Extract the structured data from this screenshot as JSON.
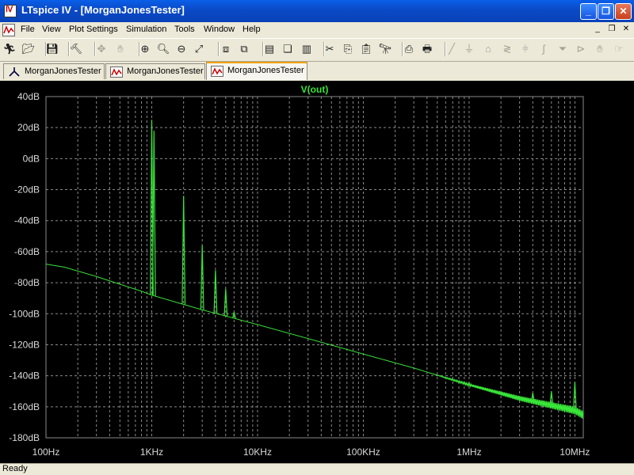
{
  "window": {
    "title": "LTspice IV - [MorganJonesTester]",
    "minimize_glyph": "_",
    "restore_glyph": "❐",
    "close_glyph": "✕"
  },
  "menu": {
    "items": [
      "File",
      "View",
      "Plot Settings",
      "Simulation",
      "Tools",
      "Window",
      "Help"
    ],
    "mdi_buttons": [
      "_",
      "❐",
      "✕"
    ]
  },
  "toolbar": {
    "icons": [
      {
        "name": "run-icon",
        "glyph": "🏃︎",
        "dim": false
      },
      {
        "name": "open-icon",
        "glyph": "📂︎",
        "dim": false
      },
      {
        "name": "save-icon",
        "glyph": "💾︎",
        "dim": false
      },
      {
        "name": "control-panel-icon",
        "glyph": "🔨︎",
        "dim": false
      },
      {
        "name": "halt-icon",
        "glyph": "✥",
        "dim": true
      },
      {
        "name": "pan-icon",
        "glyph": "✋︎",
        "dim": true
      },
      {
        "name": "zoom-in-icon",
        "glyph": "⊕",
        "dim": false
      },
      {
        "name": "zoom-area-icon",
        "glyph": "🔍︎",
        "dim": false
      },
      {
        "name": "zoom-out-icon",
        "glyph": "⊖",
        "dim": false
      },
      {
        "name": "zoom-fit-icon",
        "glyph": "⤢",
        "dim": false
      },
      {
        "name": "autorange-icon",
        "glyph": "⧈",
        "dim": false
      },
      {
        "name": "plot-setup-icon",
        "glyph": "⧉",
        "dim": false
      },
      {
        "name": "tile-horizontal-icon",
        "glyph": "▤",
        "dim": false
      },
      {
        "name": "cascade-icon",
        "glyph": "❏",
        "dim": false
      },
      {
        "name": "tile-vertical-icon",
        "glyph": "▥",
        "dim": false
      },
      {
        "name": "cut-icon",
        "glyph": "✂︎",
        "dim": false
      },
      {
        "name": "copy-icon",
        "glyph": "⎘",
        "dim": false
      },
      {
        "name": "paste-icon",
        "glyph": "📋︎",
        "dim": false
      },
      {
        "name": "find-icon",
        "glyph": "🔭︎",
        "dim": false
      },
      {
        "name": "print-setup-icon",
        "glyph": "⎙",
        "dim": false
      },
      {
        "name": "print-icon",
        "glyph": "🖶︎",
        "dim": false
      },
      {
        "name": "wire-icon",
        "glyph": "╱",
        "dim": true
      },
      {
        "name": "ground-icon",
        "glyph": "⏚",
        "dim": true
      },
      {
        "name": "label-icon",
        "glyph": "⌂",
        "dim": true
      },
      {
        "name": "resistor-icon",
        "glyph": "≷",
        "dim": true
      },
      {
        "name": "capacitor-icon",
        "glyph": "⫩",
        "dim": true
      },
      {
        "name": "inductor-icon",
        "glyph": "∫",
        "dim": true
      },
      {
        "name": "diode-icon",
        "glyph": "⏷",
        "dim": true
      },
      {
        "name": "component-icon",
        "glyph": "⊳",
        "dim": true
      },
      {
        "name": "move-icon",
        "glyph": "✋︎",
        "dim": true
      },
      {
        "name": "drag-icon",
        "glyph": "☞",
        "dim": true
      }
    ]
  },
  "tabs": [
    {
      "label": "MorganJonesTester",
      "kind": "schematic",
      "active": false
    },
    {
      "label": "MorganJonesTester",
      "kind": "waveform",
      "active": false
    },
    {
      "label": "MorganJonesTester",
      "kind": "waveform",
      "active": true
    }
  ],
  "status": {
    "text": "Ready"
  },
  "colors": {
    "trace": "#39e639",
    "trace_label": "#39e639",
    "grid": "#8a8a8a",
    "axis_text": "#d9d9d9",
    "plot_bg": "#000000"
  },
  "chart_data": {
    "type": "line",
    "title": "",
    "xlabel": "",
    "ylabel": "",
    "x_scale": "log",
    "xlim": [
      100,
      12000000
    ],
    "ylim": [
      -180,
      40
    ],
    "y_ticks": [
      40,
      20,
      0,
      -20,
      -40,
      -60,
      -80,
      -100,
      -120,
      -140,
      -160,
      -180
    ],
    "y_tick_labels": [
      "40dB",
      "20dB",
      "0dB",
      "-20dB",
      "-40dB",
      "-60dB",
      "-80dB",
      "-100dB",
      "-120dB",
      "-140dB",
      "-160dB",
      "-180dB"
    ],
    "x_ticks": [
      100,
      1000,
      10000,
      100000,
      1000000,
      10000000
    ],
    "x_tick_labels": [
      "100Hz",
      "1KHz",
      "10KHz",
      "100KHz",
      "1MHz",
      "10MHz"
    ],
    "grid": true,
    "series": [
      {
        "name": "V(out)",
        "floor": [
          [
            100,
            -68
          ],
          [
            150,
            -70
          ],
          [
            200,
            -72.5
          ],
          [
            300,
            -76
          ],
          [
            500,
            -81
          ],
          [
            800,
            -85.5
          ],
          [
            1000,
            -88
          ],
          [
            2000,
            -94
          ],
          [
            3000,
            -97.5
          ],
          [
            5000,
            -101.5
          ],
          [
            10000,
            -107
          ],
          [
            30000,
            -116
          ],
          [
            100000,
            -126
          ],
          [
            300000,
            -135
          ],
          [
            1000000,
            -146
          ],
          [
            3000000,
            -155
          ],
          [
            10000000,
            -163
          ],
          [
            12000000,
            -166
          ]
        ],
        "peaks": [
          [
            1000,
            25
          ],
          [
            1050,
            18
          ],
          [
            2000,
            -24
          ],
          [
            3000,
            -56
          ],
          [
            4000,
            -72
          ],
          [
            5000,
            -84
          ],
          [
            6000,
            -99
          ],
          [
            4000000,
            -151
          ],
          [
            6000000,
            -150
          ],
          [
            10000000,
            -144
          ]
        ]
      }
    ]
  }
}
